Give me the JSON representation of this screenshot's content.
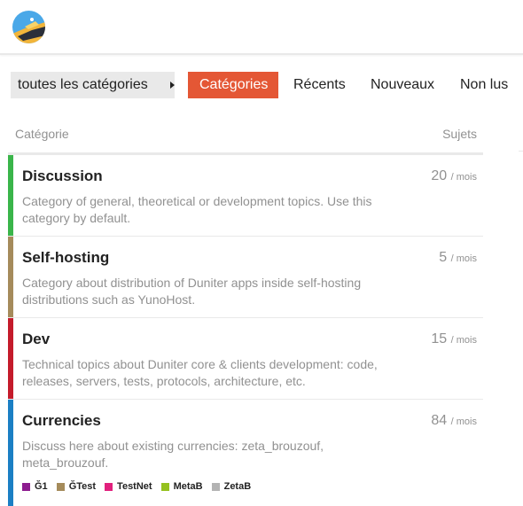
{
  "nav": {
    "dropdown_label": "toutes les catégories",
    "tabs": [
      "Catégories",
      "Récents",
      "Nouveaux",
      "Non lus"
    ]
  },
  "table": {
    "col_category": "Catégorie",
    "col_topics": "Sujets",
    "per_month": "/ mois"
  },
  "categories": [
    {
      "name": "Discussion",
      "description": "Category of general, theoretical or development topics. Use this category by default.",
      "topics": "20",
      "color": "#3ab54a"
    },
    {
      "name": "Self-hosting",
      "description": "Category about distribution of Duniter apps inside self-hosting distributions such as YunoHost.",
      "topics": "5",
      "color": "#a58b5b"
    },
    {
      "name": "Dev",
      "description": "Technical topics about Duniter core & clients development: code, releases, servers, tests, protocols, architecture, etc.",
      "topics": "15",
      "color": "#c41b2b"
    },
    {
      "name": "Currencies",
      "description": "Discuss here about existing currencies: zeta_brouzouf, meta_brouzouf.",
      "topics": "84",
      "color": "#1b7fc4",
      "subcategories": [
        {
          "name": "Ğ1",
          "color": "#8d1c8f"
        },
        {
          "name": "ĞTest",
          "color": "#a58b5b"
        },
        {
          "name": "TestNet",
          "color": "#e1207d"
        },
        {
          "name": "MetaB",
          "color": "#95c11f"
        },
        {
          "name": "ZetaB",
          "color": "#b3b3b3"
        }
      ]
    }
  ],
  "colors": {
    "accent": "#e45735",
    "muted_text": "#919191",
    "divider": "#e9e9e9"
  },
  "icons": {
    "logo": "duniter-logo",
    "dropdown": "caret-right-icon"
  }
}
